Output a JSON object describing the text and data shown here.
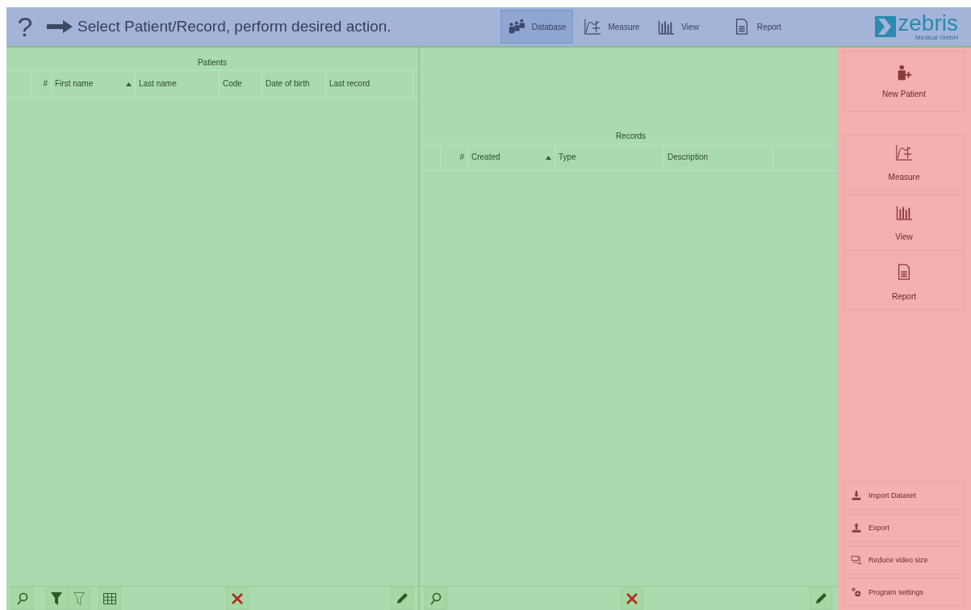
{
  "header": {
    "help": "?",
    "prompt": "Select Patient/Record, perform desired action."
  },
  "nav": [
    {
      "kind": "database",
      "label": "Database",
      "selected": true
    },
    {
      "kind": "measure",
      "label": "Measure",
      "selected": false
    },
    {
      "kind": "view",
      "label": "View",
      "selected": false
    },
    {
      "kind": "report",
      "label": "Report",
      "selected": false
    }
  ],
  "logo": {
    "name": "zebris",
    "subtitle": "Medical GmbH"
  },
  "patients": {
    "title": "Patients",
    "columns": [
      {
        "label": "#",
        "sorted": false
      },
      {
        "label": "First name",
        "sorted": true
      },
      {
        "label": "Last name",
        "sorted": false
      },
      {
        "label": "Code",
        "sorted": false
      },
      {
        "label": "Date of birth",
        "sorted": false
      },
      {
        "label": "Last record",
        "sorted": false
      }
    ]
  },
  "records": {
    "title": "Records",
    "columns": [
      {
        "label": "#",
        "sorted": false
      },
      {
        "label": "Created",
        "sorted": true
      },
      {
        "label": "Type",
        "sorted": false
      },
      {
        "label": "Description",
        "sorted": false
      }
    ]
  },
  "sidebar": {
    "top": [
      {
        "kind": "new-patient",
        "label": "New Patient"
      }
    ],
    "middle": [
      {
        "kind": "measure",
        "label": "Measure"
      },
      {
        "kind": "view",
        "label": "View"
      },
      {
        "kind": "report",
        "label": "Report"
      }
    ],
    "bottom": [
      {
        "kind": "import",
        "label": "Import Dataset"
      },
      {
        "kind": "export",
        "label": "Export"
      },
      {
        "kind": "reduce",
        "label": "Reduce video size"
      },
      {
        "kind": "settings",
        "label": "Program settings"
      }
    ]
  }
}
